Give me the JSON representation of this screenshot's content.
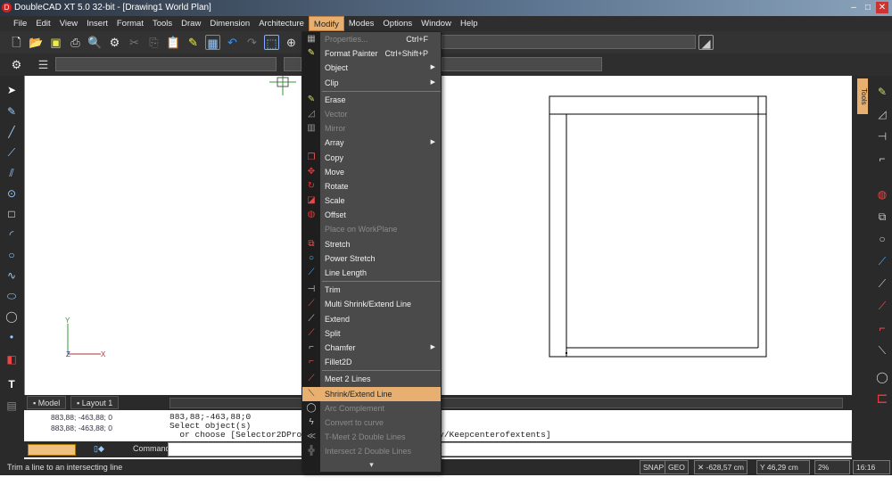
{
  "window": {
    "title": "DoubleCAD XT 5.0 32-bit - [Drawing1 World Plan]",
    "logo": "D",
    "minimize": "–",
    "maximize": "□",
    "close": "✕"
  },
  "menubar": [
    "File",
    "Edit",
    "View",
    "Insert",
    "Format",
    "Tools",
    "Draw",
    "Dimension",
    "Architecture",
    "Modify",
    "Modes",
    "Options",
    "Window",
    "Help"
  ],
  "active_menu": "Modify",
  "modify_menu": [
    {
      "label": "Properties...",
      "shortcut": "Ctrl+F",
      "disabled": true,
      "icon": "properties-icon",
      "glyph": "▦",
      "color": "#aaa"
    },
    {
      "label": "Format Painter",
      "shortcut": "Ctrl+Shift+P",
      "icon": "format-painter-icon",
      "glyph": "✎",
      "color": "#ee6"
    },
    {
      "label": "Object",
      "submenu": true
    },
    {
      "label": "Clip",
      "submenu": true,
      "sep_after": true
    },
    {
      "label": "Erase",
      "icon": "erase-icon",
      "glyph": "✎",
      "color": "#cd6"
    },
    {
      "label": "Vector",
      "disabled": true,
      "icon": "vector-icon",
      "glyph": "◿",
      "color": "#999"
    },
    {
      "label": "Mirror",
      "disabled": true,
      "icon": "mirror-icon",
      "glyph": "▥",
      "color": "#999"
    },
    {
      "label": "Array",
      "submenu": true
    },
    {
      "label": "Copy",
      "icon": "copy-icon",
      "glyph": "❐",
      "color": "#e55"
    },
    {
      "label": "Move",
      "icon": "move-icon",
      "glyph": "✥",
      "color": "#e33"
    },
    {
      "label": "Rotate",
      "icon": "rotate-icon",
      "glyph": "↻",
      "color": "#e33"
    },
    {
      "label": "Scale",
      "icon": "scale-icon",
      "glyph": "◪",
      "color": "#e44"
    },
    {
      "label": "Offset",
      "icon": "offset-icon",
      "glyph": "◍",
      "color": "#e33"
    },
    {
      "label": "Place on WorkPlane",
      "disabled": true
    },
    {
      "label": "Stretch",
      "icon": "stretch-icon",
      "glyph": "⧉",
      "color": "#e55"
    },
    {
      "label": "Power Stretch",
      "icon": "power-stretch-icon",
      "glyph": "○",
      "color": "#5cf"
    },
    {
      "label": "Line Length",
      "icon": "line-length-icon",
      "glyph": "⟋",
      "color": "#5af",
      "sep_after": true
    },
    {
      "label": "Trim",
      "icon": "trim-icon",
      "glyph": "⊣",
      "color": "#ccc"
    },
    {
      "label": "Multi Shrink/Extend Line",
      "icon": "multi-shrink-icon",
      "glyph": "⟋",
      "color": "#e55"
    },
    {
      "label": "Extend",
      "icon": "extend-icon",
      "glyph": "⟋",
      "color": "#ccc"
    },
    {
      "label": "Split",
      "icon": "split-icon",
      "glyph": "⟋",
      "color": "#e55"
    },
    {
      "label": "Chamfer",
      "submenu": true,
      "icon": "chamfer-icon",
      "glyph": "⌐",
      "color": "#ccc"
    },
    {
      "label": "Fillet2D",
      "icon": "fillet-icon",
      "glyph": "⌐",
      "color": "#e55",
      "sep_after": true
    },
    {
      "label": "Meet 2 Lines",
      "icon": "meet-lines-icon",
      "glyph": "⟋",
      "color": "#e55"
    },
    {
      "label": "Shrink/Extend Line",
      "highlighted": true,
      "icon": "shrink-extend-icon",
      "glyph": "⟍",
      "color": "#333"
    },
    {
      "label": "Arc Complement",
      "disabled": true,
      "icon": "arc-complement-icon",
      "glyph": "◯",
      "color": "#ccc"
    },
    {
      "label": "Convert to curve",
      "disabled": true,
      "icon": "convert-curve-icon",
      "glyph": "ϟ",
      "color": "#ccc"
    },
    {
      "label": "T-Meet 2 Double Lines",
      "disabled": true,
      "icon": "t-meet-icon",
      "glyph": "≪",
      "color": "#999"
    },
    {
      "label": "Intersect 2 Double Lines",
      "disabled": true,
      "icon": "intersect-icon",
      "glyph": "╬",
      "color": "#999"
    }
  ],
  "menu_scroll_down": "▾",
  "tabs": {
    "model": "Model",
    "layout": "Layout 1"
  },
  "command": {
    "history": [
      "883,88; -463,88; 0",
      "883,88; -463,88; 0"
    ],
    "output": "883,88;-463,88;0\nSelect object(s)\n  or choose [Selector2DProperties/ToggleSolid/MakeCopy/Keepcenterofextents]",
    "label": "Command:",
    "value": ""
  },
  "status": {
    "hint": "Trim a line to an intersecting line",
    "snap": "SNAP",
    "geo": "GEO",
    "x": "-628,57 cm",
    "y": "46,29 cm",
    "zoom": "2%",
    "time": "16:16"
  },
  "right_panel": {
    "tools_tab": "Tools"
  },
  "axes": {
    "y": "Y",
    "z": "Z",
    "x": "X"
  }
}
